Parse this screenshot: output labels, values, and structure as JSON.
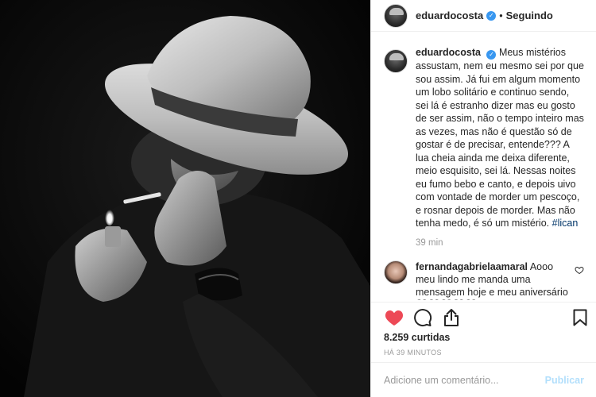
{
  "post": {
    "username": "eduardocosta",
    "follow_separator": "•",
    "follow_status": "Seguindo",
    "caption_text": "Meus mistérios assustam, nem eu mesmo sei por que sou assim. Já fui em algum momento um lobo solitário e continuo sendo, sei lá é estranho dizer mas eu gosto de ser assim, não o tempo inteiro mas as vezes, mas não é questão só de gostar é de precisar, entende??? A lua cheia ainda me deixa diferente, meio esquisito, sei lá. Nessas noites eu fumo bebo e canto, e depois uivo com vontade de morder um pescoço, e rosnar depois de morder. Mas não tenha medo, é só um mistério.",
    "caption_hashtag": "#lican",
    "caption_time": "39 min",
    "likes": "8.259 curtidas",
    "time_ago": "HÁ 39 MINUTOS"
  },
  "comments": [
    {
      "username": "fernandagabrielaamaral",
      "text": "Aooo meu lindo me manda uma mensagem hoje e meu aniversário 🖤🖤🖤🖤🖤"
    }
  ],
  "composer": {
    "placeholder": "Adicione um comentário...",
    "publish_label": "Publicar"
  },
  "colors": {
    "like_heart": "#ed4956",
    "verified": "#3897f0",
    "hashtag": "#003569",
    "publish_disabled": "#b2dffc"
  },
  "icons": {
    "like": "heart-icon",
    "comment": "comment-icon",
    "share": "share-icon",
    "save": "bookmark-icon",
    "verified": "verified-badge-icon"
  }
}
